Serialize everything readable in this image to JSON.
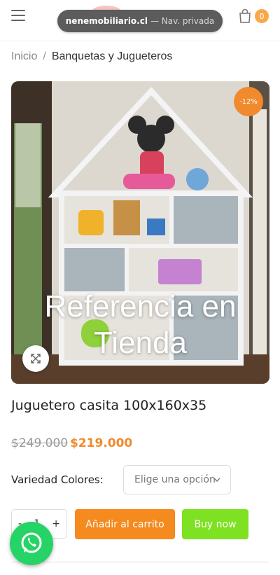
{
  "browser": {
    "domain": "nenemobiliario.cl",
    "mode": " — Nav. privada"
  },
  "header": {
    "cart_count": "0"
  },
  "breadcrumb": {
    "home": "Inicio",
    "separator": "/",
    "current": "Banquetas y Jugueteros"
  },
  "product": {
    "image_overlay_line1": "Referencia en",
    "image_overlay_line2": "Tienda",
    "sale_badge": "-12%",
    "title": "Juguetero casita 100x160x35",
    "old_price": "$249.000",
    "new_price": "$219.000",
    "variant_label": "Variedad Colores",
    "variant_colon": ":",
    "variant_placeholder": "Elige una opción",
    "qty_minus": "-",
    "qty_value": "1",
    "qty_plus": "+",
    "add_to_cart": "Añadir al carrito",
    "buy_now": "Buy now"
  },
  "colors": {
    "accent": "#f08a2c",
    "add_to_cart": "#f58a1f",
    "buy_now": "#7ee121",
    "whatsapp": "#25d366"
  },
  "icons": [
    "menu-icon",
    "cart-icon",
    "zoom-icon",
    "chevron-down-icon",
    "whatsapp-icon"
  ]
}
